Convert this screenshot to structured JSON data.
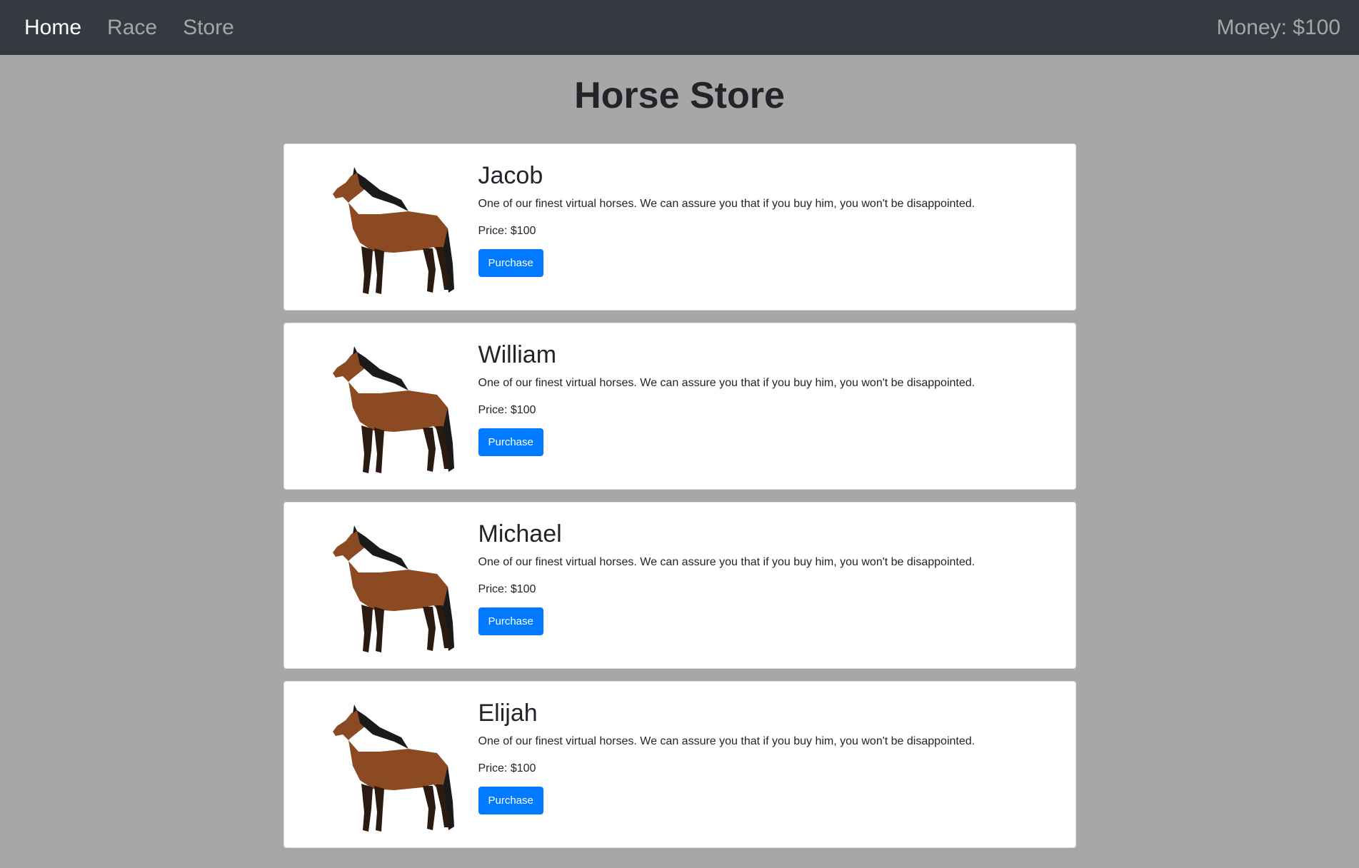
{
  "nav": {
    "items": [
      {
        "label": "Home",
        "active": true
      },
      {
        "label": "Race",
        "active": false
      },
      {
        "label": "Store",
        "active": false
      }
    ],
    "money": "Money: $100"
  },
  "page": {
    "title": "Horse Store"
  },
  "horses": [
    {
      "name": "Jacob",
      "description": "One of our finest virtual horses. We can assure you that if you buy him, you won't be disappointed.",
      "price": "Price: $100",
      "button": "Purchase"
    },
    {
      "name": "William",
      "description": "One of our finest virtual horses. We can assure you that if you buy him, you won't be disappointed.",
      "price": "Price: $100",
      "button": "Purchase"
    },
    {
      "name": "Michael",
      "description": "One of our finest virtual horses. We can assure you that if you buy him, you won't be disappointed.",
      "price": "Price: $100",
      "button": "Purchase"
    },
    {
      "name": "Elijah",
      "description": "One of our finest virtual horses. We can assure you that if you buy him, you won't be disappointed.",
      "price": "Price: $100",
      "button": "Purchase"
    }
  ],
  "colors": {
    "navbar": "#343a40",
    "background": "#a7a7a7",
    "primary": "#007bff",
    "horse_body": "#8b4a22",
    "horse_mane": "#1a1a1a"
  }
}
